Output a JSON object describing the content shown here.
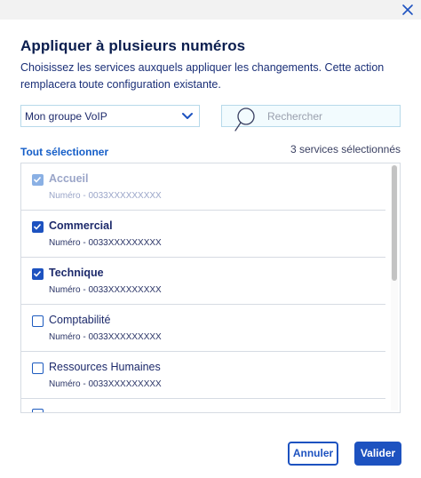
{
  "dialog": {
    "title": "Appliquer à plusieurs numéros",
    "description": "Choisissez les services auxquels appliquer les changements. Cette action remplacera toute configuration existante.",
    "close_icon": "close-icon"
  },
  "filters": {
    "group_select": {
      "value": "Mon groupe VoIP",
      "icon": "chevron-down-icon"
    },
    "search": {
      "placeholder": "Rechercher",
      "value": "",
      "icon": "search-icon"
    }
  },
  "selection": {
    "select_all_label": "Tout sélectionner",
    "count_label": "3 services sélectionnés"
  },
  "services": [
    {
      "name": "Accueil",
      "number": "Numéro - 0033XXXXXXXXX",
      "checked": true,
      "disabled": true
    },
    {
      "name": "Commercial",
      "number": "Numéro - 0033XXXXXXXXX",
      "checked": true,
      "disabled": false
    },
    {
      "name": "Technique",
      "number": "Numéro - 0033XXXXXXXXX",
      "checked": true,
      "disabled": false
    },
    {
      "name": "Comptabilité",
      "number": "Numéro - 0033XXXXXXXXX",
      "checked": false,
      "disabled": false
    },
    {
      "name": "Ressources Humaines",
      "number": "Numéro - 0033XXXXXXXXX",
      "checked": false,
      "disabled": false
    }
  ],
  "actions": {
    "cancel_label": "Annuler",
    "confirm_label": "Valider"
  },
  "colors": {
    "accent": "#1d52c0",
    "title": "#0b1e4f",
    "border": "#b7d9ea"
  }
}
